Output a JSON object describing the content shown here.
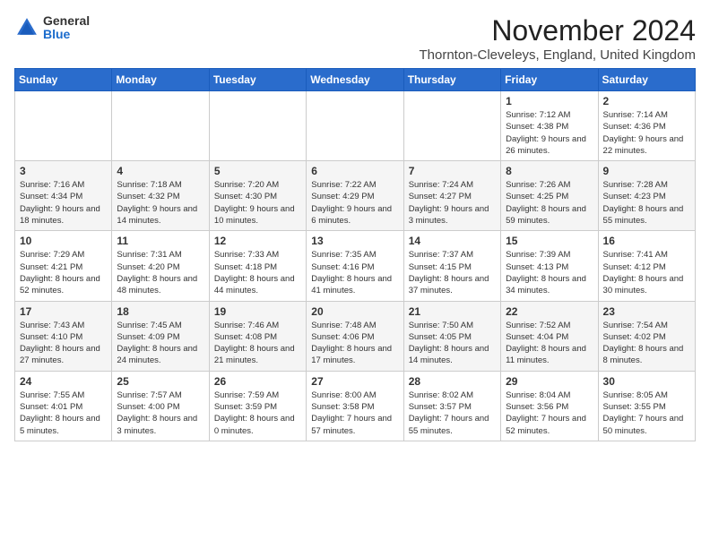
{
  "logo": {
    "general": "General",
    "blue": "Blue"
  },
  "title": "November 2024",
  "location": "Thornton-Cleveleys, England, United Kingdom",
  "days_of_week": [
    "Sunday",
    "Monday",
    "Tuesday",
    "Wednesday",
    "Thursday",
    "Friday",
    "Saturday"
  ],
  "weeks": [
    [
      {
        "day": "",
        "info": ""
      },
      {
        "day": "",
        "info": ""
      },
      {
        "day": "",
        "info": ""
      },
      {
        "day": "",
        "info": ""
      },
      {
        "day": "",
        "info": ""
      },
      {
        "day": "1",
        "info": "Sunrise: 7:12 AM\nSunset: 4:38 PM\nDaylight: 9 hours\nand 26 minutes."
      },
      {
        "day": "2",
        "info": "Sunrise: 7:14 AM\nSunset: 4:36 PM\nDaylight: 9 hours\nand 22 minutes."
      }
    ],
    [
      {
        "day": "3",
        "info": "Sunrise: 7:16 AM\nSunset: 4:34 PM\nDaylight: 9 hours\nand 18 minutes."
      },
      {
        "day": "4",
        "info": "Sunrise: 7:18 AM\nSunset: 4:32 PM\nDaylight: 9 hours\nand 14 minutes."
      },
      {
        "day": "5",
        "info": "Sunrise: 7:20 AM\nSunset: 4:30 PM\nDaylight: 9 hours\nand 10 minutes."
      },
      {
        "day": "6",
        "info": "Sunrise: 7:22 AM\nSunset: 4:29 PM\nDaylight: 9 hours\nand 6 minutes."
      },
      {
        "day": "7",
        "info": "Sunrise: 7:24 AM\nSunset: 4:27 PM\nDaylight: 9 hours\nand 3 minutes."
      },
      {
        "day": "8",
        "info": "Sunrise: 7:26 AM\nSunset: 4:25 PM\nDaylight: 8 hours\nand 59 minutes."
      },
      {
        "day": "9",
        "info": "Sunrise: 7:28 AM\nSunset: 4:23 PM\nDaylight: 8 hours\nand 55 minutes."
      }
    ],
    [
      {
        "day": "10",
        "info": "Sunrise: 7:29 AM\nSunset: 4:21 PM\nDaylight: 8 hours\nand 52 minutes."
      },
      {
        "day": "11",
        "info": "Sunrise: 7:31 AM\nSunset: 4:20 PM\nDaylight: 8 hours\nand 48 minutes."
      },
      {
        "day": "12",
        "info": "Sunrise: 7:33 AM\nSunset: 4:18 PM\nDaylight: 8 hours\nand 44 minutes."
      },
      {
        "day": "13",
        "info": "Sunrise: 7:35 AM\nSunset: 4:16 PM\nDaylight: 8 hours\nand 41 minutes."
      },
      {
        "day": "14",
        "info": "Sunrise: 7:37 AM\nSunset: 4:15 PM\nDaylight: 8 hours\nand 37 minutes."
      },
      {
        "day": "15",
        "info": "Sunrise: 7:39 AM\nSunset: 4:13 PM\nDaylight: 8 hours\nand 34 minutes."
      },
      {
        "day": "16",
        "info": "Sunrise: 7:41 AM\nSunset: 4:12 PM\nDaylight: 8 hours\nand 30 minutes."
      }
    ],
    [
      {
        "day": "17",
        "info": "Sunrise: 7:43 AM\nSunset: 4:10 PM\nDaylight: 8 hours\nand 27 minutes."
      },
      {
        "day": "18",
        "info": "Sunrise: 7:45 AM\nSunset: 4:09 PM\nDaylight: 8 hours\nand 24 minutes."
      },
      {
        "day": "19",
        "info": "Sunrise: 7:46 AM\nSunset: 4:08 PM\nDaylight: 8 hours\nand 21 minutes."
      },
      {
        "day": "20",
        "info": "Sunrise: 7:48 AM\nSunset: 4:06 PM\nDaylight: 8 hours\nand 17 minutes."
      },
      {
        "day": "21",
        "info": "Sunrise: 7:50 AM\nSunset: 4:05 PM\nDaylight: 8 hours\nand 14 minutes."
      },
      {
        "day": "22",
        "info": "Sunrise: 7:52 AM\nSunset: 4:04 PM\nDaylight: 8 hours\nand 11 minutes."
      },
      {
        "day": "23",
        "info": "Sunrise: 7:54 AM\nSunset: 4:02 PM\nDaylight: 8 hours\nand 8 minutes."
      }
    ],
    [
      {
        "day": "24",
        "info": "Sunrise: 7:55 AM\nSunset: 4:01 PM\nDaylight: 8 hours\nand 5 minutes."
      },
      {
        "day": "25",
        "info": "Sunrise: 7:57 AM\nSunset: 4:00 PM\nDaylight: 8 hours\nand 3 minutes."
      },
      {
        "day": "26",
        "info": "Sunrise: 7:59 AM\nSunset: 3:59 PM\nDaylight: 8 hours\nand 0 minutes."
      },
      {
        "day": "27",
        "info": "Sunrise: 8:00 AM\nSunset: 3:58 PM\nDaylight: 7 hours\nand 57 minutes."
      },
      {
        "day": "28",
        "info": "Sunrise: 8:02 AM\nSunset: 3:57 PM\nDaylight: 7 hours\nand 55 minutes."
      },
      {
        "day": "29",
        "info": "Sunrise: 8:04 AM\nSunset: 3:56 PM\nDaylight: 7 hours\nand 52 minutes."
      },
      {
        "day": "30",
        "info": "Sunrise: 8:05 AM\nSunset: 3:55 PM\nDaylight: 7 hours\nand 50 minutes."
      }
    ]
  ]
}
